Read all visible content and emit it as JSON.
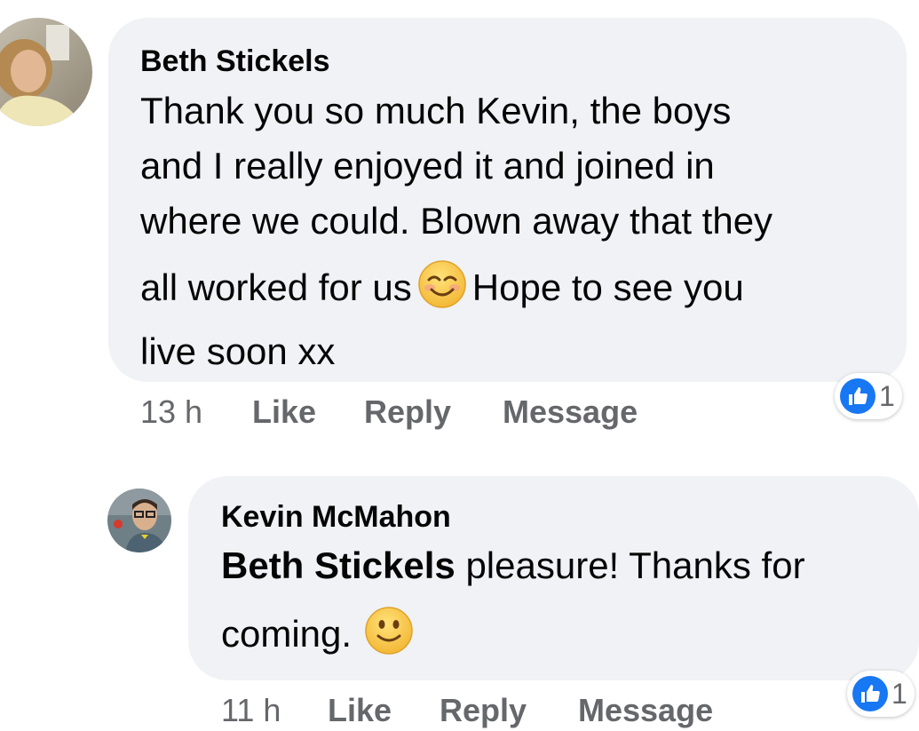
{
  "comments": [
    {
      "author": "Beth Stickels",
      "text_lines": [
        "Thank you so much Kevin, the boys",
        "and I really enjoyed it and joined in",
        "where we could. Blown away that they"
      ],
      "text_line4_before": "all worked for us",
      "emoji_1": "smiling-face-with-smiling-eyes",
      "text_line4_after": "Hope to see you",
      "text_line5": "live soon xx",
      "time": "13 h",
      "like_label": "Like",
      "reply_label": "Reply",
      "message_label": "Message",
      "reaction_count": "1"
    },
    {
      "author": "Kevin McMahon",
      "mention": "Beth Stickels",
      "text_line1_rest": " pleasure! Thanks for",
      "text_line2": "coming.",
      "emoji_1": "slightly-smiling-face",
      "time": "11 h",
      "like_label": "Like",
      "reply_label": "Reply",
      "message_label": "Message",
      "reaction_count": "1"
    }
  ],
  "colors": {
    "bubble": "#f0f2f5",
    "meta_text": "#65676b",
    "like_blue": "#1877f2",
    "emoji_yellow": "#f7c84a"
  }
}
